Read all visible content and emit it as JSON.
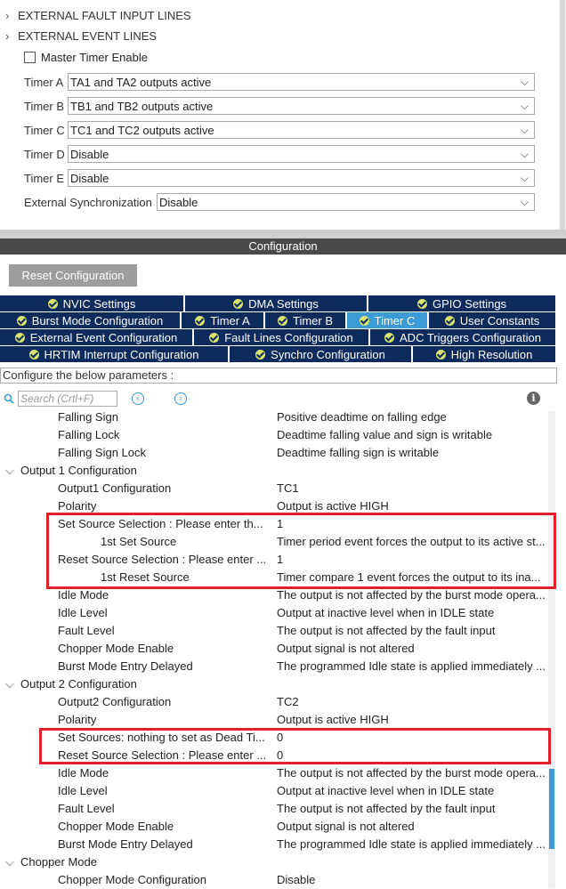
{
  "top": {
    "sections": [
      "EXTERNAL FAULT INPUT LINES",
      "EXTERNAL EVENT LINES"
    ],
    "master_timer_label": "Master Timer Enable",
    "fields": [
      {
        "label": "Timer A",
        "value": "TA1 and TA2 outputs active"
      },
      {
        "label": "Timer B",
        "value": "TB1 and TB2 outputs active"
      },
      {
        "label": "Timer C",
        "value": "TC1 and TC2 outputs active"
      },
      {
        "label": "Timer D",
        "value": "Disable"
      },
      {
        "label": "Timer E",
        "value": "Disable"
      },
      {
        "label": "External Synchronization",
        "value": "Disable"
      }
    ]
  },
  "config": {
    "header": "Configuration",
    "reset_label": "Reset Configuration",
    "tabs_row1": [
      "NVIC Settings",
      "DMA Settings",
      "GPIO Settings"
    ],
    "tabs_row2": [
      "Burst Mode Configuration",
      "Timer A",
      "Timer B",
      "Timer C",
      "User Constants"
    ],
    "tabs_row3": [
      "External Event Configuration",
      "Fault Lines Configuration",
      "ADC Triggers Configuration"
    ],
    "tabs_row4": [
      "HRTIM Interrupt Configuration",
      "Synchro Configuration",
      "High Resolution"
    ],
    "active_tab": "Timer C",
    "instruction": "Configure the below parameters :",
    "search_placeholder": "Search (Crtl+F)"
  },
  "tree": [
    {
      "name": "Falling Sign",
      "value": "Positive deadtime on falling edge"
    },
    {
      "name": "Falling Lock",
      "value": "Deadtime falling value and sign is writable"
    },
    {
      "name": "Falling Sign Lock",
      "value": "Deadtime falling sign is writable"
    },
    {
      "name": "Output 1 Configuration",
      "value": ""
    },
    {
      "name": "Output1 Configuration",
      "value": "TC1"
    },
    {
      "name": "Polarity",
      "value": "Output is active HIGH"
    },
    {
      "name": "Set Source  Selection : Please enter th...",
      "value": "1"
    },
    {
      "name": "1st Set Source",
      "value": "Timer period event forces the output to its active st..."
    },
    {
      "name": "Reset Source  Selection : Please enter ...",
      "value": "1"
    },
    {
      "name": "1st Reset Source",
      "value": "Timer compare 1 event forces the output to its ina..."
    },
    {
      "name": "Idle Mode",
      "value": "The output is not affected by the burst mode opera..."
    },
    {
      "name": "Idle Level",
      "value": "Output at inactive level when in IDLE state"
    },
    {
      "name": "Fault Level",
      "value": "The output is not affected by the fault input"
    },
    {
      "name": "Chopper Mode Enable",
      "value": "Output signal is not altered"
    },
    {
      "name": "Burst Mode Entry Delayed",
      "value": "The programmed Idle state is applied immediately ..."
    },
    {
      "name": "Output 2 Configuration",
      "value": ""
    },
    {
      "name": "Output2 Configuration",
      "value": "TC2"
    },
    {
      "name": "Polarity",
      "value": "Output is active HIGH"
    },
    {
      "name": "Set Sources: nothing to set as Dead Ti...",
      "value": "0"
    },
    {
      "name": "Reset Source  Selection : Please enter ...",
      "value": "0"
    },
    {
      "name": "Idle Mode",
      "value": "The output is not affected by the burst mode opera..."
    },
    {
      "name": "Idle Level",
      "value": "Output at inactive level when in IDLE state"
    },
    {
      "name": "Fault Level",
      "value": "The output is not affected by the fault input"
    },
    {
      "name": "Chopper Mode Enable",
      "value": "Output signal is not altered"
    },
    {
      "name": "Burst Mode Entry Delayed",
      "value": "The programmed Idle state is applied immediately ..."
    },
    {
      "name": "Chopper Mode",
      "value": ""
    },
    {
      "name": "Chopper Mode Configuration",
      "value": "Disable"
    }
  ],
  "colors": {
    "tab_bg": "#0d2b5c",
    "tab_active": "#3a9bd5",
    "highlight": "#e0202a"
  },
  "icons": {
    "expand": "chevron-right-icon",
    "collapse": "chevron-down-icon",
    "search": "search-icon",
    "info": "info-icon"
  }
}
